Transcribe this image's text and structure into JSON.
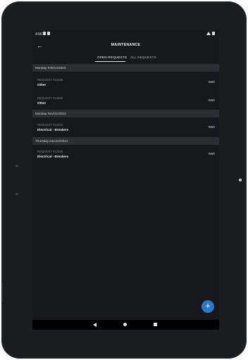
{
  "status_bar": {
    "time": "4:56"
  },
  "app_bar": {
    "title": "MAINTENANCE"
  },
  "tabs": [
    {
      "label": "OPEN REQUESTS",
      "active": true
    },
    {
      "label": "ALL REQUESTS",
      "active": false
    }
  ],
  "groups": [
    {
      "date": "Monday Feb/13/2023",
      "items": [
        {
          "request": "REQUEST #12365",
          "category": "Other",
          "source": "Web"
        },
        {
          "request": "REQUEST #12362",
          "category": "Other",
          "source": "Web"
        }
      ]
    },
    {
      "date": "Monday Nov/21/2022",
      "items": [
        {
          "request": "REQUEST #12301",
          "category": "Electrical - Breakers",
          "source": "Web"
        }
      ]
    },
    {
      "date": "Thursday Dec/23/2021",
      "items": [
        {
          "request": "REQUEST #12280",
          "category": "Electrical - Breakers",
          "source": "Web"
        }
      ]
    }
  ],
  "fab": {
    "icon": "plus-icon"
  },
  "colors": {
    "background": "#16181c",
    "section": "#2b2e33",
    "accent": "#2d78c6"
  }
}
